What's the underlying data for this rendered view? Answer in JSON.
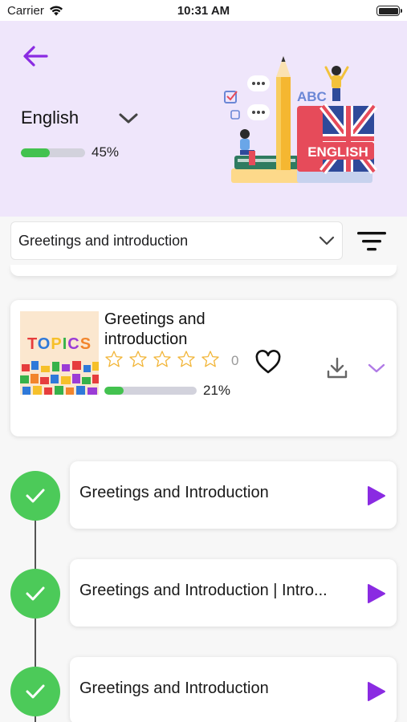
{
  "status_bar": {
    "carrier": "Carrier",
    "time": "10:31 AM"
  },
  "header": {
    "language": "English",
    "progress_percent": 45,
    "progress_label": "45%",
    "illustration": {
      "abc_text": "ABC",
      "book_text": "ENGLISH"
    }
  },
  "filter": {
    "selected_topic": "Greetings and introduction"
  },
  "course": {
    "thumbnail_text": "TOPICS",
    "title": "Greetings and introduction",
    "rating_stars": 0,
    "rating_count": "0",
    "progress_percent": 21,
    "progress_label": "21%"
  },
  "lessons": [
    {
      "title": "Greetings and Introduction",
      "completed": true
    },
    {
      "title": "Greetings and Introduction | Intro...",
      "completed": true
    },
    {
      "title": "Greetings and Introduction",
      "completed": true
    }
  ],
  "colors": {
    "accent_purple": "#8a2be2",
    "header_bg": "#efe6fb",
    "progress_green": "#43c24f",
    "check_green": "#4cca59",
    "star_outline": "#f2b63a"
  },
  "icons": {
    "back": "arrow-left-icon",
    "language_dropdown": "chevron-down-icon",
    "filter": "filter-icon",
    "favorite": "heart-icon",
    "download": "download-icon",
    "expand": "chevron-down-icon",
    "lesson_done": "checkmark-icon",
    "play": "play-icon"
  }
}
